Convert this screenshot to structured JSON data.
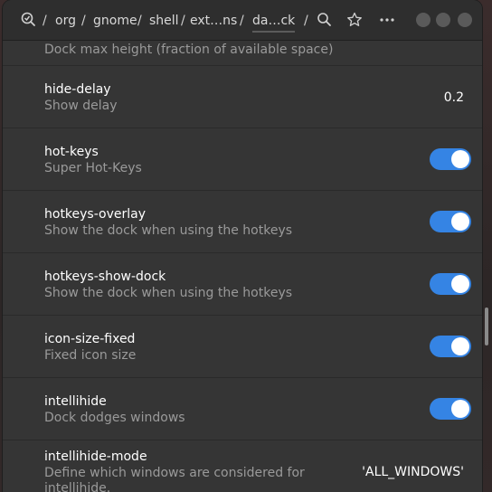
{
  "breadcrumb": {
    "root_icon": "dconf-icon",
    "separator": "/",
    "items": [
      "org",
      "gnome",
      "shell",
      "ext…ns",
      "da…ck"
    ]
  },
  "header": {
    "search_icon": "search-icon",
    "bookmark_icon": "star-icon",
    "menu_icon": "more-options-icon"
  },
  "rows": [
    {
      "title": "",
      "subtitle": "Dock max height (fraction of available space)",
      "value": ""
    },
    {
      "title": "hide-delay",
      "subtitle": "Show delay",
      "value": "0.2"
    },
    {
      "title": "hot-keys",
      "subtitle": "Super Hot-Keys",
      "toggle": true
    },
    {
      "title": "hotkeys-overlay",
      "subtitle": "Show the dock when using the hotkeys",
      "toggle": true
    },
    {
      "title": "hotkeys-show-dock",
      "subtitle": "Show the dock when using the hotkeys",
      "toggle": true
    },
    {
      "title": "icon-size-fixed",
      "subtitle": "Fixed icon size",
      "toggle": true
    },
    {
      "title": "intellihide",
      "subtitle": "Dock dodges windows",
      "toggle": true
    },
    {
      "title": "intellihide-mode",
      "subtitle": "Define which windows are considered for",
      "subtitle_line2": "intellihide.",
      "value": "'ALL_WINDOWS'"
    }
  ],
  "colors": {
    "accent": "#3584e4",
    "window_bg": "#353535",
    "header_bg": "#2e2e2e",
    "subtitle": "#9a9a9a"
  }
}
